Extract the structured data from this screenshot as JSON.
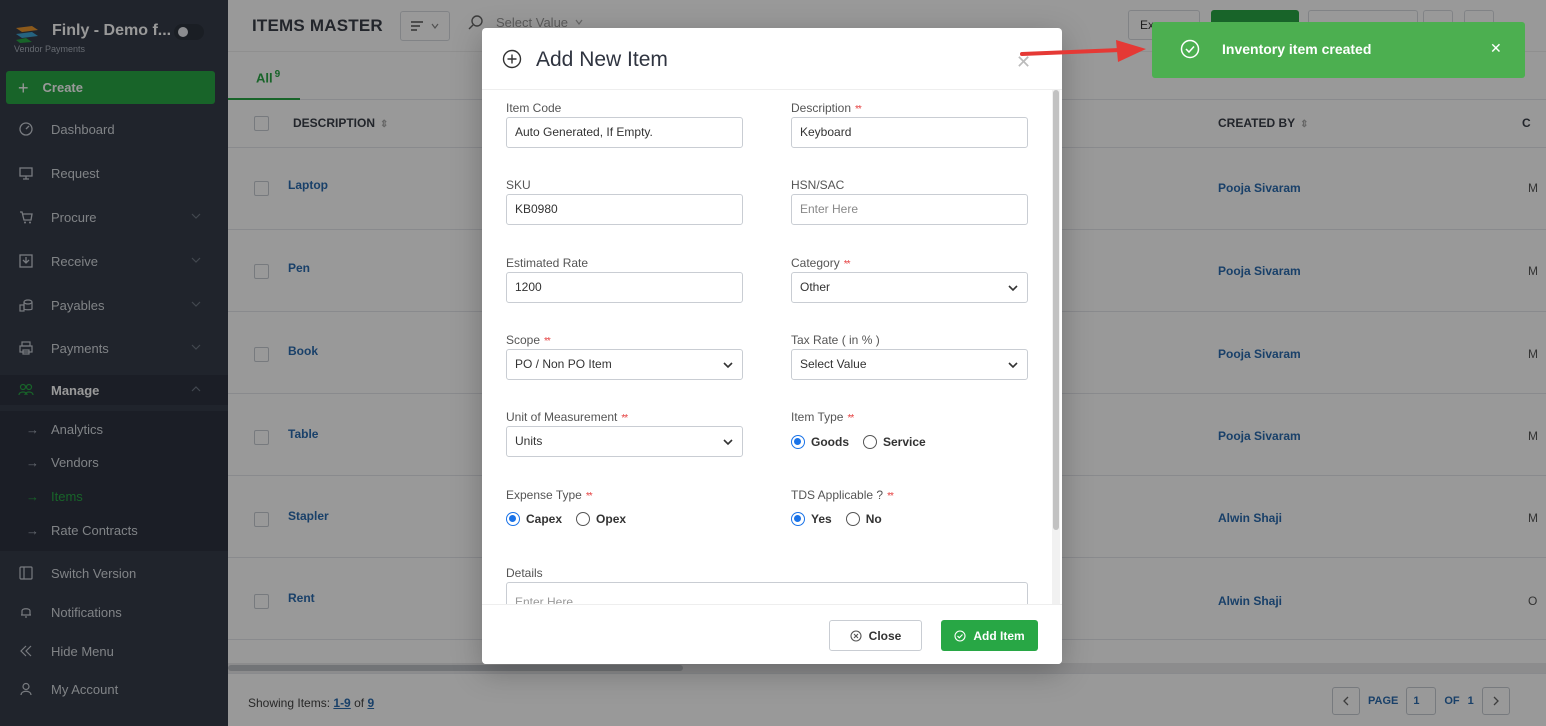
{
  "sidebar": {
    "brand_title": "Finly - Demo f...",
    "brand_sub": "Vendor Payments",
    "create_label": "Create",
    "items": {
      "dashboard": "Dashboard",
      "request": "Request",
      "procure": "Procure",
      "receive": "Receive",
      "payables": "Payables",
      "payments": "Payments",
      "manage": "Manage",
      "analytics": "Analytics",
      "vendors": "Vendors",
      "items": "Items",
      "rate_contracts": "Rate Contracts",
      "switch_version": "Switch Version",
      "notifications": "Notifications",
      "hide_menu": "Hide Menu",
      "my_account": "My Account"
    },
    "accent": "#28a745"
  },
  "header": {
    "page_title": "ITEMS MASTER",
    "search_placeholder": "Select Value",
    "export_label": "Ex"
  },
  "tabs": {
    "all_label": "All",
    "all_count": "9"
  },
  "table": {
    "col_description": "DESCRIPTION",
    "col_created_by": "CREATED BY",
    "col_c": "C",
    "rows": [
      {
        "desc": "Laptop",
        "creator": "Pooja Sivaram",
        "c": "M"
      },
      {
        "desc": "Pen",
        "creator": "Pooja Sivaram",
        "c": "M"
      },
      {
        "desc": "Book",
        "creator": "Pooja Sivaram",
        "c": "M"
      },
      {
        "desc": "Table",
        "creator": "Pooja Sivaram",
        "c": "M"
      },
      {
        "desc": "Stapler",
        "creator": "Alwin Shaji",
        "c": "M"
      },
      {
        "desc": "Rent",
        "creator": "Alwin Shaji",
        "c": "O"
      }
    ]
  },
  "footer": {
    "showing_label": "Showing Items:",
    "showing_range": "1-9",
    "showing_of": "of",
    "showing_total": "9",
    "page_label": "PAGE",
    "page_value": "1",
    "of_label": "OF",
    "page_total": "1"
  },
  "modal": {
    "title": "Add New Item",
    "fields": {
      "item_code_label": "Item Code",
      "item_code_value": "Auto Generated, If Empty.",
      "description_label": "Description",
      "description_value": "Keyboard",
      "sku_label": "SKU",
      "sku_value": "KB0980",
      "hsn_label": "HSN/SAC",
      "hsn_placeholder": "Enter Here",
      "rate_label": "Estimated Rate",
      "rate_value": "1200",
      "category_label": "Category",
      "category_value": "Other",
      "scope_label": "Scope",
      "scope_value": "PO / Non PO Item",
      "tax_label": "Tax Rate ( in % )",
      "tax_value": "Select Value",
      "uom_label": "Unit of Measurement",
      "uom_value": "Units",
      "item_type_label": "Item Type",
      "item_type_goods": "Goods",
      "item_type_service": "Service",
      "expense_label": "Expense Type",
      "expense_capex": "Capex",
      "expense_opex": "Opex",
      "tds_label": "TDS Applicable ?",
      "tds_yes": "Yes",
      "tds_no": "No",
      "details_label": "Details",
      "details_placeholder": "Enter Here"
    },
    "required_mark": "**",
    "close_label": "Close",
    "add_label": "Add Item"
  },
  "toast": {
    "message": "Inventory item created",
    "color": "#4caf50"
  }
}
